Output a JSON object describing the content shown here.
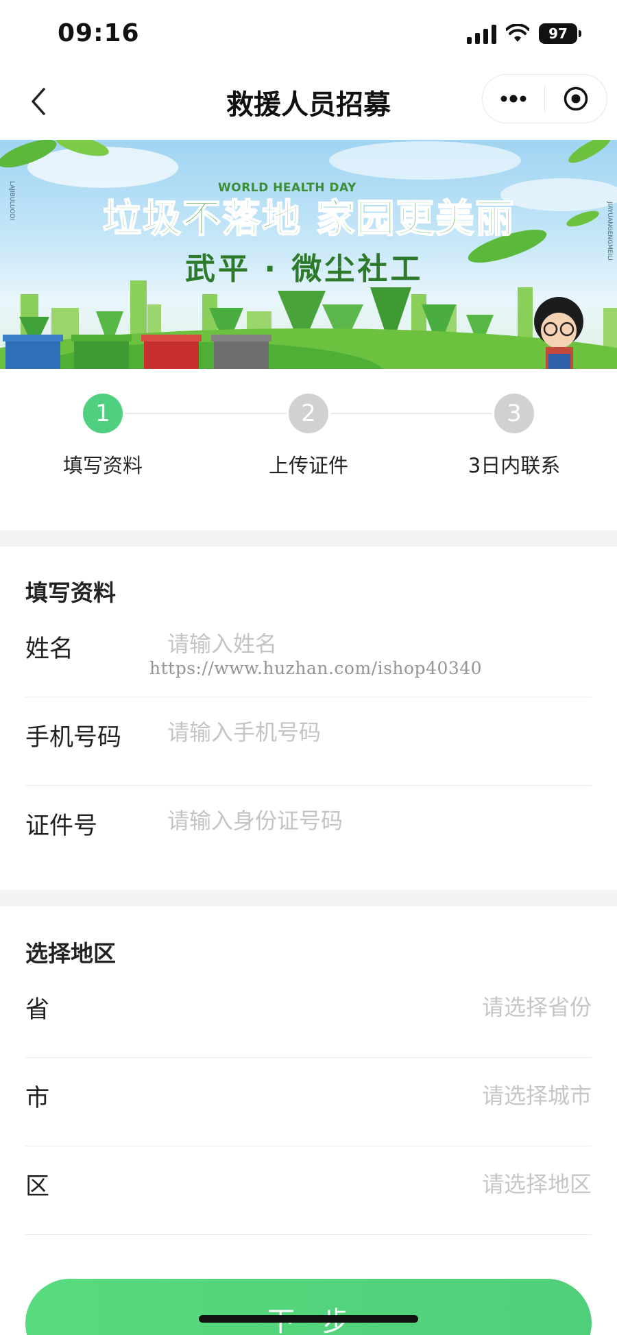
{
  "status_bar": {
    "time": "09:16",
    "battery": "97"
  },
  "nav": {
    "title": "救援人员招募"
  },
  "banner": {
    "en_title": "WORLD HEALTH DAY",
    "title": "垃圾不落地 家园更美丽",
    "subtitle": "武平 · 微尘社工",
    "side_left": "LAJIBULUODI",
    "side_right": "JIAYUANGENGMEILI"
  },
  "steps": [
    {
      "number": "1",
      "label": "填写资料",
      "active": true
    },
    {
      "number": "2",
      "label": "上传证件",
      "active": false
    },
    {
      "number": "3",
      "label": "3日内联系",
      "active": false
    }
  ],
  "info_section": {
    "title": "填写资料",
    "fields": [
      {
        "label": "姓名",
        "placeholder": "请输入姓名"
      },
      {
        "label": "手机号码",
        "placeholder": "请输入手机号码"
      },
      {
        "label": "证件号",
        "placeholder": "请输入身份证号码"
      }
    ]
  },
  "region_section": {
    "title": "选择地区",
    "pickers": [
      {
        "label": "省",
        "placeholder": "请选择省份"
      },
      {
        "label": "市",
        "placeholder": "请选择城市"
      },
      {
        "label": "区",
        "placeholder": "请选择地区"
      }
    ]
  },
  "watermark": "https://www.huzhan.com/ishop40340",
  "next_button": "下一步",
  "colors": {
    "accent": "#4fcf80",
    "inactive_step": "#d1d1d1",
    "section_gap": "#f3f3f6",
    "placeholder": "#c4c4c4"
  }
}
